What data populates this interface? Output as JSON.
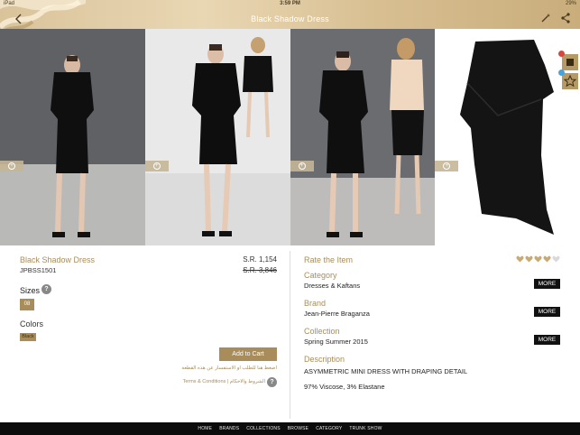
{
  "status_bar": {
    "device": "iPad",
    "time": "3:59 PM",
    "battery": "29%"
  },
  "header": {
    "title": "Black Shadow Dress",
    "back_icon": "chevron-left-icon",
    "colors": {
      "gold_light": "#e9d7b3",
      "gold_dark": "#c9ad7b"
    }
  },
  "product": {
    "name": "Black Shadow Dress",
    "sku": "JPBSS1501",
    "price": "S.R. 1,154",
    "old_price": "S.R. 3,846",
    "sizes_label": "Sizes",
    "sizes": [
      "08"
    ],
    "colors_label": "Colors",
    "colors": [
      "Black"
    ],
    "add_to_cart": "Add to Cart",
    "arabic_note": "اضغط هنا للطلب او الاستفسار عن هذه القطعة",
    "terms": "Terms & Conditions | الشروط والاحكام"
  },
  "rating": {
    "label": "Rate the Item",
    "value": 4,
    "max": 5
  },
  "info": {
    "category_title": "Category",
    "category": "Dresses & Kaftans",
    "brand_title": "Brand",
    "brand": "Jean-Pierre Braganza",
    "collection_title": "Collection",
    "collection": "Spring Summer 2015",
    "description_title": "Description",
    "description": "ASYMMETRIC MINI DRESS WITH DRAPING DETAIL",
    "composition": "97% Viscose, 3% Elastane",
    "more_label": "MORE"
  },
  "side_buttons": {
    "badge_red": "#d9453a",
    "badge_blue": "#4aa3d8"
  },
  "nav": [
    "HOME",
    "BRANDS",
    "COLLECTIONS",
    "BROWSE",
    "CATEGORY",
    "TRUNK SHOW"
  ],
  "accent": "#a88d5a"
}
